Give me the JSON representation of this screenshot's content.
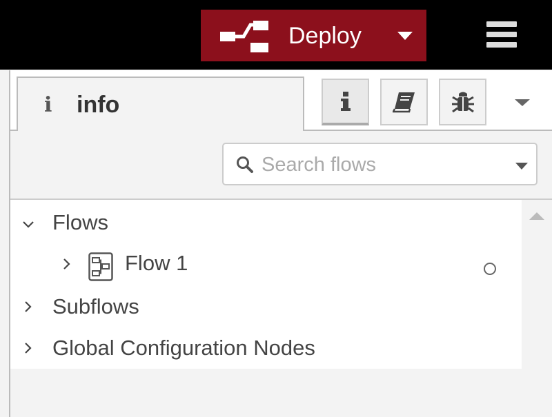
{
  "header": {
    "deploy_label": "Deploy",
    "deploy_color": "#8c101c",
    "deploy_icon": "deploy-icon",
    "menu_icon": "hamburger-menu-icon"
  },
  "sidebar": {
    "active_tab": {
      "icon": "info-icon",
      "label": "info"
    },
    "tool_buttons": [
      {
        "icon": "info-icon",
        "active": true
      },
      {
        "icon": "book-icon",
        "active": false
      },
      {
        "icon": "bug-icon",
        "active": false
      }
    ],
    "search": {
      "placeholder": "Search flows",
      "value": ""
    },
    "tree": {
      "flows_label": "Flows",
      "flow_1_label": "Flow 1",
      "subflows_label": "Subflows",
      "global_config_label": "Global Configuration Nodes"
    }
  }
}
